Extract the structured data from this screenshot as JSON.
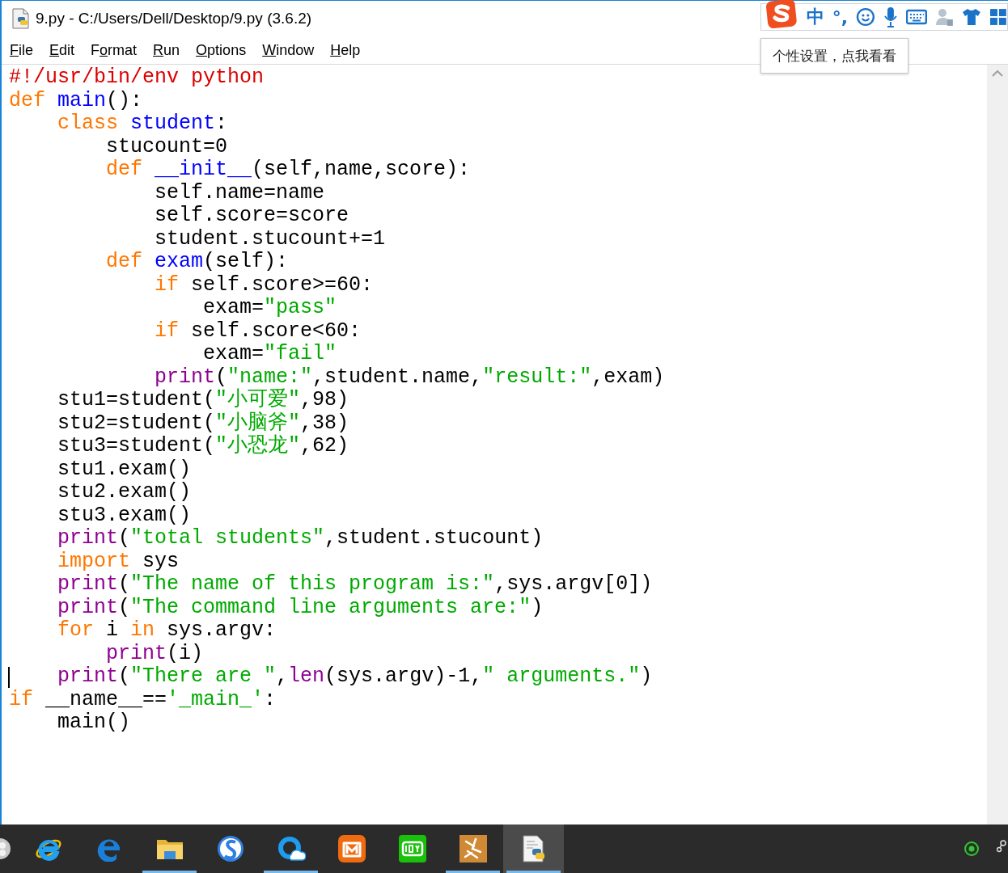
{
  "window": {
    "title": "9.py - C:/Users/Dell/Desktop/9.py (3.6.2)"
  },
  "menu": [
    {
      "key": "F",
      "after": "ile"
    },
    {
      "key": "E",
      "after": "dit"
    },
    {
      "before": "F",
      "key": "o",
      "after": "rmat"
    },
    {
      "key": "R",
      "after": "un"
    },
    {
      "key": "O",
      "after": "ptions"
    },
    {
      "key": "W",
      "after": "indow"
    },
    {
      "key": "H",
      "after": "elp"
    }
  ],
  "ime_toolbar": {
    "mode": "中",
    "punctuation": "°,",
    "tooltip": "个性设置，点我看看"
  },
  "editor": {
    "lines": [
      {
        "cursor": false,
        "tokens": [
          {
            "kind": "comment",
            "text": "#!/usr/bin/env python"
          }
        ]
      },
      {
        "cursor": false,
        "tokens": [
          {
            "kind": "keyword",
            "text": "def"
          },
          {
            "kind": "name",
            "text": " main"
          },
          {
            "kind": "plain",
            "text": "():"
          }
        ]
      },
      {
        "cursor": false,
        "tokens": [
          {
            "kind": "keyword",
            "text": "    class"
          },
          {
            "kind": "name",
            "text": " student"
          },
          {
            "kind": "plain",
            "text": ":"
          }
        ]
      },
      {
        "cursor": false,
        "tokens": [
          {
            "kind": "plain",
            "text": "        stucount=0"
          }
        ]
      },
      {
        "cursor": false,
        "tokens": [
          {
            "kind": "keyword",
            "text": "        def"
          },
          {
            "kind": "name",
            "text": " __init__"
          },
          {
            "kind": "plain",
            "text": "(self,name,score):"
          }
        ]
      },
      {
        "cursor": false,
        "tokens": [
          {
            "kind": "plain",
            "text": "            self.name=name"
          }
        ]
      },
      {
        "cursor": false,
        "tokens": [
          {
            "kind": "plain",
            "text": "            self.score=score"
          }
        ]
      },
      {
        "cursor": false,
        "tokens": [
          {
            "kind": "plain",
            "text": "            student.stucount+=1"
          }
        ]
      },
      {
        "cursor": false,
        "tokens": [
          {
            "kind": "keyword",
            "text": "        def"
          },
          {
            "kind": "name",
            "text": " exam"
          },
          {
            "kind": "plain",
            "text": "(self):"
          }
        ]
      },
      {
        "cursor": false,
        "tokens": [
          {
            "kind": "keyword",
            "text": "            if"
          },
          {
            "kind": "plain",
            "text": " self.score>=60:"
          }
        ]
      },
      {
        "cursor": false,
        "tokens": [
          {
            "kind": "plain",
            "text": "                exam="
          },
          {
            "kind": "string",
            "text": "\"pass\""
          }
        ]
      },
      {
        "cursor": false,
        "tokens": [
          {
            "kind": "keyword",
            "text": "            if"
          },
          {
            "kind": "plain",
            "text": " self.score<60:"
          }
        ]
      },
      {
        "cursor": false,
        "tokens": [
          {
            "kind": "plain",
            "text": "                exam="
          },
          {
            "kind": "string",
            "text": "\"fail\""
          }
        ]
      },
      {
        "cursor": false,
        "tokens": [
          {
            "kind": "builtin",
            "text": "            print"
          },
          {
            "kind": "plain",
            "text": "("
          },
          {
            "kind": "string",
            "text": "\"name:\""
          },
          {
            "kind": "plain",
            "text": ",student.name,"
          },
          {
            "kind": "string",
            "text": "\"result:\""
          },
          {
            "kind": "plain",
            "text": ",exam)"
          }
        ]
      },
      {
        "cursor": false,
        "tokens": [
          {
            "kind": "plain",
            "text": "    stu1=student("
          },
          {
            "kind": "string",
            "text": "\"小可爱\""
          },
          {
            "kind": "plain",
            "text": ",98)"
          }
        ]
      },
      {
        "cursor": false,
        "tokens": [
          {
            "kind": "plain",
            "text": "    stu2=student("
          },
          {
            "kind": "string",
            "text": "\"小脑斧\""
          },
          {
            "kind": "plain",
            "text": ",38)"
          }
        ]
      },
      {
        "cursor": false,
        "tokens": [
          {
            "kind": "plain",
            "text": "    stu3=student("
          },
          {
            "kind": "string",
            "text": "\"小恐龙\""
          },
          {
            "kind": "plain",
            "text": ",62)"
          }
        ]
      },
      {
        "cursor": false,
        "tokens": [
          {
            "kind": "plain",
            "text": "    stu1.exam()"
          }
        ]
      },
      {
        "cursor": false,
        "tokens": [
          {
            "kind": "plain",
            "text": "    stu2.exam()"
          }
        ]
      },
      {
        "cursor": false,
        "tokens": [
          {
            "kind": "plain",
            "text": "    stu3.exam()"
          }
        ]
      },
      {
        "cursor": false,
        "tokens": [
          {
            "kind": "builtin",
            "text": "    print"
          },
          {
            "kind": "plain",
            "text": "("
          },
          {
            "kind": "string",
            "text": "\"total students\""
          },
          {
            "kind": "plain",
            "text": ",student.stucount)"
          }
        ]
      },
      {
        "cursor": false,
        "tokens": [
          {
            "kind": "keyword",
            "text": "    import"
          },
          {
            "kind": "plain",
            "text": " sys"
          }
        ]
      },
      {
        "cursor": false,
        "tokens": [
          {
            "kind": "builtin",
            "text": "    print"
          },
          {
            "kind": "plain",
            "text": "("
          },
          {
            "kind": "string",
            "text": "\"The name of this program is:\""
          },
          {
            "kind": "plain",
            "text": ",sys.argv[0])"
          }
        ]
      },
      {
        "cursor": false,
        "tokens": [
          {
            "kind": "builtin",
            "text": "    print"
          },
          {
            "kind": "plain",
            "text": "("
          },
          {
            "kind": "string",
            "text": "\"The command line arguments are:\""
          },
          {
            "kind": "plain",
            "text": ")"
          }
        ]
      },
      {
        "cursor": false,
        "tokens": [
          {
            "kind": "keyword",
            "text": "    for"
          },
          {
            "kind": "plain",
            "text": " i "
          },
          {
            "kind": "keyword",
            "text": "in"
          },
          {
            "kind": "plain",
            "text": " sys.argv:"
          }
        ]
      },
      {
        "cursor": false,
        "tokens": [
          {
            "kind": "builtin",
            "text": "        print"
          },
          {
            "kind": "plain",
            "text": "(i)"
          }
        ]
      },
      {
        "cursor": true,
        "tokens": [
          {
            "kind": "builtin",
            "text": "    print"
          },
          {
            "kind": "plain",
            "text": "("
          },
          {
            "kind": "string",
            "text": "\"There are \""
          },
          {
            "kind": "plain",
            "text": ","
          },
          {
            "kind": "builtin",
            "text": "len"
          },
          {
            "kind": "plain",
            "text": "(sys.argv)-1,"
          },
          {
            "kind": "string",
            "text": "\" arguments.\""
          },
          {
            "kind": "plain",
            "text": ")"
          }
        ]
      },
      {
        "cursor": false,
        "tokens": [
          {
            "kind": "keyword",
            "text": "if"
          },
          {
            "kind": "plain",
            "text": " __name__=="
          },
          {
            "kind": "string",
            "text": "'_main_'"
          },
          {
            "kind": "plain",
            "text": ":"
          }
        ]
      },
      {
        "cursor": false,
        "tokens": [
          {
            "kind": "plain",
            "text": "    main()"
          }
        ]
      }
    ]
  },
  "taskbar": {
    "apps": [
      {
        "kind": "partial",
        "running": false,
        "selected": false
      },
      {
        "kind": "ie",
        "running": false,
        "selected": false
      },
      {
        "kind": "edge",
        "running": false,
        "selected": false
      },
      {
        "kind": "folder",
        "running": true,
        "selected": false
      },
      {
        "kind": "sbrowser",
        "running": false,
        "selected": false
      },
      {
        "kind": "cloud",
        "running": true,
        "selected": false
      },
      {
        "kind": "mango",
        "running": false,
        "selected": false
      },
      {
        "kind": "video",
        "running": false,
        "selected": false
      },
      {
        "kind": "brush",
        "running": true,
        "selected": false
      },
      {
        "kind": "idle",
        "running": true,
        "selected": true
      }
    ]
  }
}
